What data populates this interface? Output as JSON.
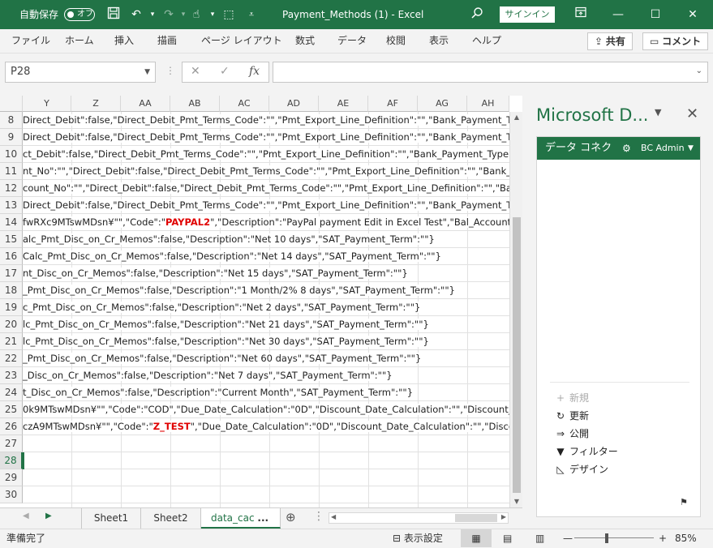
{
  "titlebar": {
    "autosave_label": "自動保存",
    "autosave_state": "オフ",
    "doc_title": "Payment_Methods (1)  -  Excel",
    "signin": "サインイン"
  },
  "menu": {
    "items": [
      "ファイル",
      "ホーム",
      "挿入",
      "描画",
      "ページ レイアウト",
      "数式",
      "データ",
      "校閲",
      "表示",
      "ヘルプ"
    ],
    "share": "共有",
    "comment": "コメント"
  },
  "formula": {
    "namebox": "P28",
    "fx": "fx",
    "content": ""
  },
  "columns": [
    "Y",
    "Z",
    "AA",
    "AB",
    "AC",
    "AD",
    "AE",
    "AF",
    "AG",
    "AH"
  ],
  "rows": [
    {
      "num": "8",
      "pre": "Direct_Debit\":false,\"Direct_Debit_Pmt_Terms_Code\":\"\",\"Pmt_Export_Line_Definition\":\"\",\"Bank_Payment_Type\"",
      "red": "",
      "post": ""
    },
    {
      "num": "9",
      "pre": "Direct_Debit\":false,\"Direct_Debit_Pmt_Terms_Code\":\"\",\"Pmt_Export_Line_Definition\":\"\",\"Bank_Payment_Type\"",
      "red": "",
      "post": ""
    },
    {
      "num": "10",
      "pre": "ct_Debit\":false,\"Direct_Debit_Pmt_Terms_Code\":\"\",\"Pmt_Export_Line_Definition\":\"\",\"Bank_Payment_Type\":\"",
      "red": "",
      "post": ""
    },
    {
      "num": "11",
      "pre": "nt_No\":\"\",\"Direct_Debit\":false,\"Direct_Debit_Pmt_Terms_Code\":\"\",\"Pmt_Export_Line_Definition\":\"\",\"Bank_Pa",
      "red": "",
      "post": ""
    },
    {
      "num": "12",
      "pre": "count_No\":\"\",\"Direct_Debit\":false,\"Direct_Debit_Pmt_Terms_Code\":\"\",\"Pmt_Export_Line_Definition\":\"\",\"Bank_",
      "red": "",
      "post": ""
    },
    {
      "num": "13",
      "pre": "Direct_Debit\":false,\"Direct_Debit_Pmt_Terms_Code\":\"\",\"Pmt_Export_Line_Definition\":\"\",\"Bank_Payment_Type",
      "red": "",
      "post": ""
    },
    {
      "num": "14",
      "pre": "fwRXc9MTswMDsn¥\"\",\"Code\":\"",
      "red": "PAYPAL2",
      "post": "\",\"Description\":\"PayPal payment Edit in Excel Test\",\"Bal_Account_T"
    },
    {
      "num": "15",
      "pre": "alc_Pmt_Disc_on_Cr_Memos\":false,\"Description\":\"Net 10 days\",\"SAT_Payment_Term\":\"\"}",
      "red": "",
      "post": ""
    },
    {
      "num": "16",
      "pre": "Calc_Pmt_Disc_on_Cr_Memos\":false,\"Description\":\"Net 14 days\",\"SAT_Payment_Term\":\"\"}",
      "red": "",
      "post": ""
    },
    {
      "num": "17",
      "pre": "nt_Disc_on_Cr_Memos\":false,\"Description\":\"Net 15 days\",\"SAT_Payment_Term\":\"\"}",
      "red": "",
      "post": ""
    },
    {
      "num": "18",
      "pre": "_Pmt_Disc_on_Cr_Memos\":false,\"Description\":\"1 Month/2% 8 days\",\"SAT_Payment_Term\":\"\"}",
      "red": "",
      "post": ""
    },
    {
      "num": "19",
      "pre": "c_Pmt_Disc_on_Cr_Memos\":false,\"Description\":\"Net 2 days\",\"SAT_Payment_Term\":\"\"}",
      "red": "",
      "post": ""
    },
    {
      "num": "20",
      "pre": "lc_Pmt_Disc_on_Cr_Memos\":false,\"Description\":\"Net 21 days\",\"SAT_Payment_Term\":\"\"}",
      "red": "",
      "post": ""
    },
    {
      "num": "21",
      "pre": "lc_Pmt_Disc_on_Cr_Memos\":false,\"Description\":\"Net 30 days\",\"SAT_Payment_Term\":\"\"}",
      "red": "",
      "post": ""
    },
    {
      "num": "22",
      "pre": "_Pmt_Disc_on_Cr_Memos\":false,\"Description\":\"Net 60 days\",\"SAT_Payment_Term\":\"\"}",
      "red": "",
      "post": ""
    },
    {
      "num": "23",
      "pre": "_Disc_on_Cr_Memos\":false,\"Description\":\"Net 7 days\",\"SAT_Payment_Term\":\"\"}",
      "red": "",
      "post": ""
    },
    {
      "num": "24",
      "pre": "t_Disc_on_Cr_Memos\":false,\"Description\":\"Current Month\",\"SAT_Payment_Term\":\"\"}",
      "red": "",
      "post": ""
    },
    {
      "num": "25",
      "pre": "0k9MTswMDsn¥\"\",\"Code\":\"COD\",\"Due_Date_Calculation\":\"0D\",\"Discount_Date_Calculation\":\"\",\"Discount_P",
      "red": "",
      "post": ""
    },
    {
      "num": "26",
      "pre": "czA9MTswMDsn¥\"\",\"Code\":\"",
      "red": "Z_TEST",
      "post": "\",\"Due_Date_Calculation\":\"0D\",\"Discount_Date_Calculation\":\"\",\"Discou"
    },
    {
      "num": "27",
      "pre": "",
      "red": "",
      "post": ""
    },
    {
      "num": "28",
      "pre": "",
      "red": "",
      "post": ""
    },
    {
      "num": "29",
      "pre": "",
      "red": "",
      "post": ""
    },
    {
      "num": "30",
      "pre": "",
      "red": "",
      "post": ""
    }
  ],
  "selected_row": "28",
  "tabs": {
    "items": [
      "Sheet1",
      "Sheet2",
      "data_cac"
    ],
    "more": "...",
    "active": "data_cac"
  },
  "pane": {
    "title": "Microsoft D...",
    "header": "データ コネク",
    "user": "BC Admin",
    "actions": [
      {
        "label": "新規",
        "icon": "+",
        "disabled": true
      },
      {
        "label": "更新",
        "icon": "↻",
        "disabled": false
      },
      {
        "label": "公開",
        "icon": "⇒",
        "disabled": false
      },
      {
        "label": "フィルター",
        "icon": "▼",
        "disabled": false
      },
      {
        "label": "デザイン",
        "icon": "◺",
        "disabled": false
      }
    ]
  },
  "status": {
    "ready": "準備完了",
    "display_settings": "表示設定",
    "zoom": "85%"
  },
  "colors": {
    "accent": "#217346",
    "red_text": "#e00000"
  }
}
